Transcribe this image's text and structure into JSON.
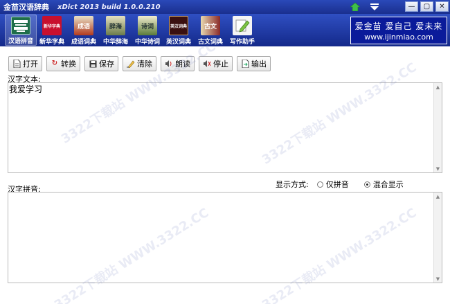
{
  "window": {
    "title": "金苗汉语辞典",
    "build": "xDict 2013  build 1.0.0.210"
  },
  "nav": {
    "items": [
      {
        "label": "汉语拼音",
        "icon_text": "拼",
        "color": "#1f6e4a"
      },
      {
        "label": "新华字典",
        "icon_text": "新华字典",
        "color": "#c8102e"
      },
      {
        "label": "成语词典",
        "icon_text": "成语",
        "color": "#b23a1e"
      },
      {
        "label": "中华辞海",
        "icon_text": "辞海",
        "color": "#6b7c4a"
      },
      {
        "label": "中华诗词",
        "icon_text": "诗词",
        "color": "#5a7c3a"
      },
      {
        "label": "英汉词典",
        "icon_text": "英汉词典",
        "color": "#3a1010"
      },
      {
        "label": "古文词典",
        "icon_text": "古文",
        "color": "#8a2a2a"
      },
      {
        "label": "写作助手",
        "icon_text": "✎",
        "color": "#f4f4f4"
      }
    ]
  },
  "brand": {
    "line1": "爱金苗 爱自己 爱未来",
    "line2": "www.ijinmiao.com"
  },
  "actions": [
    {
      "label": "打开",
      "icon": "open-icon"
    },
    {
      "label": "转换",
      "icon": "convert-icon"
    },
    {
      "label": "保存",
      "icon": "save-icon"
    },
    {
      "label": "清除",
      "icon": "clear-icon"
    },
    {
      "label": "朗读",
      "icon": "speak-icon"
    },
    {
      "label": "停止",
      "icon": "stop-icon"
    },
    {
      "label": "输出",
      "icon": "export-icon"
    }
  ],
  "text_panel": {
    "label": "汉字文本:",
    "value": "我爱学习"
  },
  "pinyin_panel": {
    "label": "汉字拼音:",
    "value": ""
  },
  "display_mode": {
    "label": "显示方式:",
    "options": [
      "仅拼音",
      "混合显示"
    ],
    "selected": "混合显示"
  },
  "watermark": "3322下载站  WWW.3322.CC"
}
